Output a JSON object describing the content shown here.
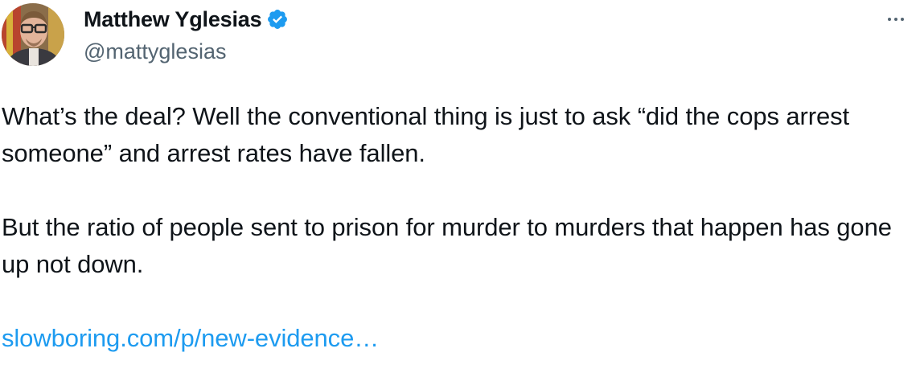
{
  "author": {
    "display_name": "Matthew Yglesias",
    "handle": "@mattyglesias",
    "verified": true,
    "verified_icon": "verified-badge-icon",
    "verified_color": "#1d9bf0"
  },
  "menu": {
    "icon": "more-options-icon"
  },
  "tweet": {
    "paragraph_1": "What’s the deal? Well the conventional thing is just to ask “did the cops arrest someone” and arrest rates have fallen.",
    "paragraph_2": "But the ratio of people sent to prison for murder to murders that happen has gone up not down.",
    "link_text": "slowboring.com/p/new-evidence…",
    "link_color": "#1d9bf0"
  }
}
